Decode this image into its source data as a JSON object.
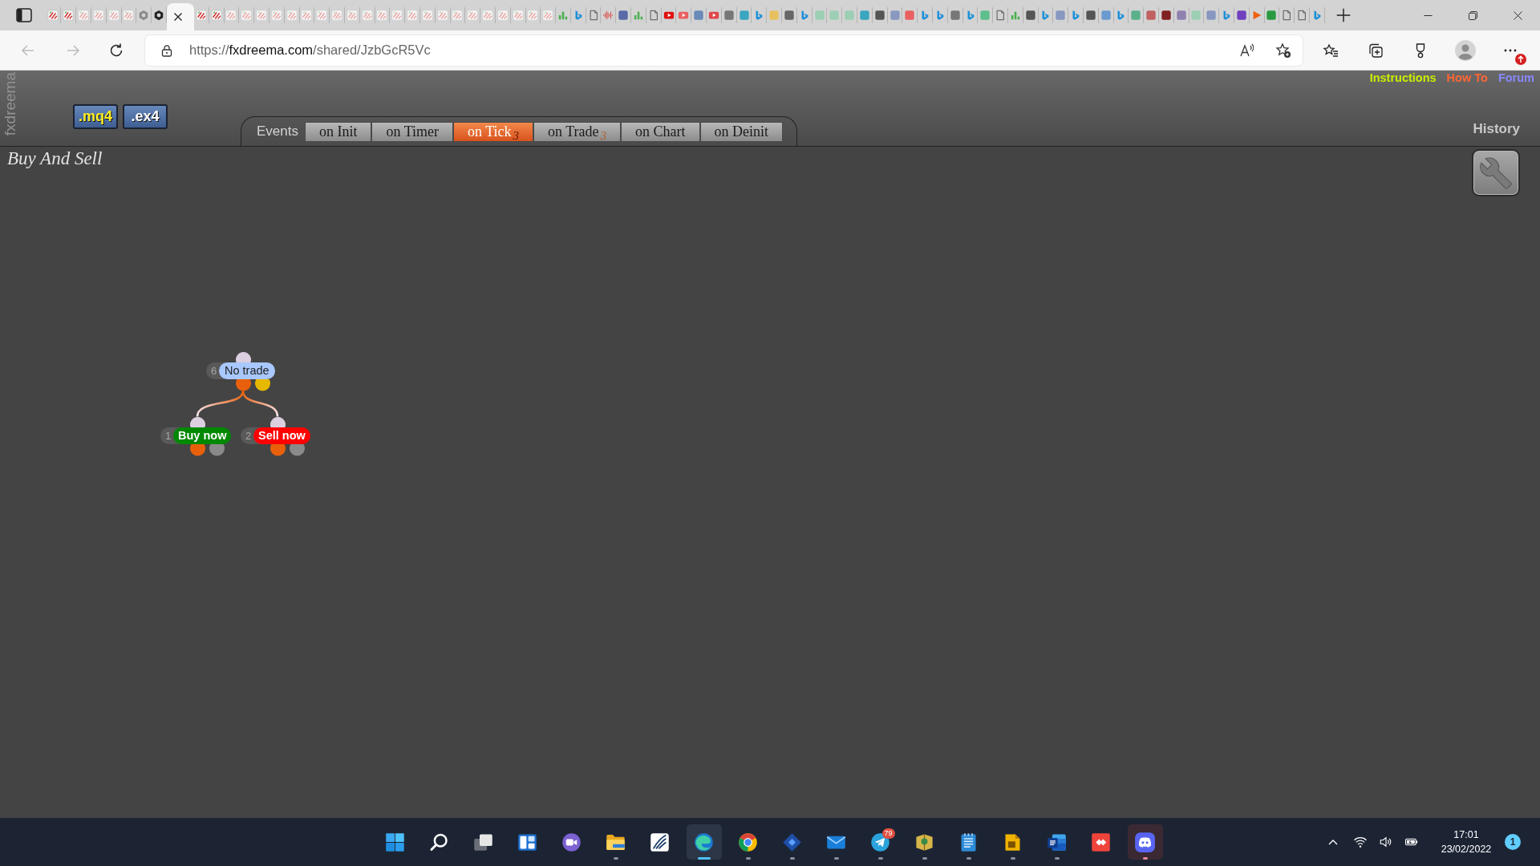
{
  "browser": {
    "tabs": [
      {
        "kind": "fx",
        "sleeping": false,
        "selected": false
      },
      {
        "kind": "fx",
        "sleeping": false,
        "selected": false
      },
      {
        "kind": "fx",
        "sleeping": true,
        "selected": false
      },
      {
        "kind": "fx",
        "sleeping": true,
        "selected": false
      },
      {
        "kind": "fx",
        "sleeping": true,
        "selected": false
      },
      {
        "kind": "fx",
        "sleeping": true,
        "selected": false
      },
      {
        "kind": "hex",
        "color": "#8a8a8a",
        "sleeping": false,
        "selected": false
      },
      {
        "kind": "hex",
        "color": "#222222",
        "sleeping": false,
        "selected": false
      },
      {
        "sleeping": false,
        "selected": true
      },
      {
        "kind": "fx",
        "sleeping": false,
        "selected": false
      },
      {
        "kind": "fx",
        "sleeping": false,
        "selected": false
      },
      {
        "kind": "fx",
        "sleeping": true,
        "selected": false
      },
      {
        "kind": "fx",
        "sleeping": true,
        "selected": false
      },
      {
        "kind": "fx",
        "sleeping": true,
        "selected": false
      },
      {
        "kind": "fx",
        "sleeping": true,
        "selected": false
      },
      {
        "kind": "fx",
        "sleeping": true,
        "selected": false
      },
      {
        "kind": "fx",
        "sleeping": true,
        "selected": false
      },
      {
        "kind": "fx",
        "sleeping": true,
        "selected": false
      },
      {
        "kind": "fx",
        "sleeping": true,
        "selected": false
      },
      {
        "kind": "fx",
        "sleeping": true,
        "selected": false
      },
      {
        "kind": "fx",
        "sleeping": true,
        "selected": false
      },
      {
        "kind": "fx",
        "sleeping": true,
        "selected": false
      },
      {
        "kind": "fx",
        "sleeping": true,
        "selected": false
      },
      {
        "kind": "fx",
        "sleeping": true,
        "selected": false
      },
      {
        "kind": "fx",
        "sleeping": true,
        "selected": false
      },
      {
        "kind": "fx",
        "sleeping": true,
        "selected": false
      },
      {
        "kind": "fx",
        "sleeping": true,
        "selected": false
      },
      {
        "kind": "fx",
        "sleeping": true,
        "selected": false
      },
      {
        "kind": "fx",
        "sleeping": true,
        "selected": false
      },
      {
        "kind": "fx",
        "sleeping": true,
        "selected": false
      },
      {
        "kind": "fx",
        "sleeping": true,
        "selected": false
      },
      {
        "kind": "fx",
        "sleeping": true,
        "selected": false
      },
      {
        "kind": "fx",
        "sleeping": true,
        "selected": false
      },
      {
        "kind": "bars",
        "sleeping": false,
        "selected": false
      },
      {
        "kind": "b",
        "sleeping": false,
        "selected": false
      },
      {
        "kind": "page",
        "sleeping": false,
        "selected": false
      },
      {
        "kind": "wave",
        "sleeping": false,
        "selected": false
      },
      {
        "kind": "tile",
        "color": "#5a6aa8",
        "sleeping": false,
        "selected": false
      },
      {
        "kind": "bars",
        "sleeping": false,
        "selected": false
      },
      {
        "kind": "page",
        "sleeping": false,
        "selected": false
      },
      {
        "kind": "play",
        "color": "#e01010",
        "sleeping": false,
        "selected": false
      },
      {
        "kind": "play",
        "color": "#e86060",
        "sleeping": false,
        "selected": false
      },
      {
        "kind": "tile",
        "color": "#6a8ab8",
        "sleeping": false,
        "selected": false
      },
      {
        "kind": "play",
        "color": "#e04848",
        "sleeping": false,
        "selected": false
      },
      {
        "kind": "tile",
        "color": "#777777",
        "sleeping": false,
        "selected": false
      },
      {
        "kind": "tile",
        "color": "#3aa6c0",
        "sleeping": false,
        "selected": false
      },
      {
        "kind": "b",
        "sleeping": false,
        "selected": false
      },
      {
        "kind": "tile",
        "color": "#e8c060",
        "sleeping": false,
        "selected": false
      },
      {
        "kind": "tile",
        "color": "#666666",
        "sleeping": false,
        "selected": false
      },
      {
        "kind": "b",
        "sleeping": false,
        "selected": false
      },
      {
        "kind": "tile",
        "color": "#9ccfb4",
        "sleeping": false,
        "selected": false
      },
      {
        "kind": "tile",
        "color": "#9ccfb4",
        "sleeping": false,
        "selected": false
      },
      {
        "kind": "tile",
        "color": "#9ccfb4",
        "sleeping": false,
        "selected": false
      },
      {
        "kind": "tile",
        "color": "#3aa6c0",
        "sleeping": false,
        "selected": false
      },
      {
        "kind": "tile",
        "color": "#555555",
        "sleeping": false,
        "selected": false
      },
      {
        "kind": "tile",
        "color": "#8898c0",
        "sleeping": false,
        "selected": false
      },
      {
        "kind": "tile",
        "color": "#e86060",
        "sleeping": false,
        "selected": false
      },
      {
        "kind": "b",
        "sleeping": false,
        "selected": false
      },
      {
        "kind": "b",
        "sleeping": false,
        "selected": false
      },
      {
        "kind": "tile",
        "color": "#777777",
        "sleeping": false,
        "selected": false
      },
      {
        "kind": "b",
        "sleeping": false,
        "selected": false
      },
      {
        "kind": "tile",
        "color": "#5cbf8c",
        "sleeping": false,
        "selected": false
      },
      {
        "kind": "page",
        "sleeping": false,
        "selected": false
      },
      {
        "kind": "bars",
        "sleeping": false,
        "selected": false
      },
      {
        "kind": "tile",
        "color": "#555555",
        "sleeping": false,
        "selected": false
      },
      {
        "kind": "b",
        "sleeping": false,
        "selected": false
      },
      {
        "kind": "tile",
        "color": "#8898c0",
        "sleeping": false,
        "selected": false
      },
      {
        "kind": "b",
        "sleeping": false,
        "selected": false
      },
      {
        "kind": "tile",
        "color": "#555555",
        "sleeping": false,
        "selected": false
      },
      {
        "kind": "tile",
        "color": "#6a9ad0",
        "sleeping": false,
        "selected": false
      },
      {
        "kind": "b",
        "sleeping": false,
        "selected": false
      },
      {
        "kind": "tile",
        "color": "#5ab08a",
        "sleeping": false,
        "selected": false
      },
      {
        "kind": "tile",
        "color": "#c06060",
        "sleeping": false,
        "selected": false
      },
      {
        "kind": "tile",
        "color": "#802020",
        "sleeping": false,
        "selected": false
      },
      {
        "kind": "tile",
        "color": "#9080b0",
        "sleeping": false,
        "selected": false
      },
      {
        "kind": "tile",
        "color": "#9ccfb4",
        "sleeping": false,
        "selected": false
      },
      {
        "kind": "tile",
        "color": "#8898c0",
        "sleeping": false,
        "selected": false
      },
      {
        "kind": "b",
        "sleeping": false,
        "selected": false
      },
      {
        "kind": "tile",
        "color": "#7040c0",
        "sleeping": false,
        "selected": false
      },
      {
        "kind": "triangle",
        "color": "#f06010",
        "sleeping": false,
        "selected": false
      },
      {
        "kind": "tile",
        "color": "#2a9a40",
        "sleeping": false,
        "selected": false
      },
      {
        "kind": "page",
        "sleeping": false,
        "selected": false
      },
      {
        "kind": "page",
        "sleeping": false,
        "selected": false
      },
      {
        "kind": "b",
        "sleeping": false,
        "selected": false
      }
    ],
    "nav": {
      "back_disabled": true,
      "forward_disabled": true
    },
    "url": {
      "scheme": "https://",
      "host": "fxdreema.com",
      "path": "/shared/JzbGcR5Vc"
    }
  },
  "header": {
    "brand": "fxdreema",
    "downloads": [
      {
        "label": ".mq4",
        "color": "#ffee22"
      },
      {
        "label": ".ex4",
        "color": "#ffffff"
      }
    ],
    "events_label": "Events",
    "event_tabs": [
      {
        "label": "on Init",
        "selected": false
      },
      {
        "label": "on Timer",
        "selected": false
      },
      {
        "label": "on Tick",
        "count": "3",
        "selected": true
      },
      {
        "label": "on Trade",
        "count": "3",
        "selected": false
      },
      {
        "label": "on Chart",
        "selected": false
      },
      {
        "label": "on Deinit",
        "selected": false
      }
    ],
    "links": [
      {
        "label": "Instructions",
        "color": "#ccee00"
      },
      {
        "label": "How To",
        "color": "#ff6633"
      },
      {
        "label": "Forum",
        "color": "#8888ff"
      }
    ],
    "history": "History"
  },
  "canvas": {
    "title": "Buy And Sell",
    "blocks": [
      {
        "kind": "condition",
        "number": "6",
        "label": "No trade",
        "color": "#a8c8ff",
        "outputs": [
          {
            "color": "#e8600c",
            "children": [
              {
                "kind": "action",
                "number": "1",
                "label": "Buy now",
                "color": "#008800",
                "outputs": [
                  {
                    "color": "#e8600c"
                  },
                  {
                    "color": "#8a8a8a"
                  }
                ]
              },
              {
                "kind": "action",
                "number": "2",
                "label": "Sell now",
                "color": "#ff0000",
                "outputs": [
                  {
                    "color": "#e8600c"
                  },
                  {
                    "color": "#8a8a8a"
                  }
                ]
              }
            ]
          },
          {
            "color": "#e6b800"
          }
        ]
      }
    ]
  },
  "taskbar": {
    "apps": [
      {
        "kind": "start",
        "running": false,
        "selected": false,
        "alert": false
      },
      {
        "kind": "search",
        "running": false,
        "selected": false,
        "alert": false
      },
      {
        "kind": "task_view",
        "running": false,
        "selected": false,
        "alert": false
      },
      {
        "kind": "widgets",
        "running": false,
        "selected": false,
        "alert": false
      },
      {
        "kind": "chat",
        "running": false,
        "selected": false,
        "alert": false
      },
      {
        "kind": "files",
        "running": true,
        "selected": false,
        "alert": false
      },
      {
        "kind": "feather",
        "running": false,
        "selected": false,
        "alert": false
      },
      {
        "kind": "edge",
        "running": true,
        "selected": true,
        "alert": false
      },
      {
        "kind": "chrome",
        "running": true,
        "selected": false,
        "alert": false
      },
      {
        "kind": "diamond",
        "running": true,
        "selected": false,
        "alert": false
      },
      {
        "kind": "mail",
        "running": true,
        "selected": false,
        "alert": false
      },
      {
        "kind": "telegram",
        "running": true,
        "selected": false,
        "alert": false,
        "badge": "79"
      },
      {
        "kind": "book",
        "running": true,
        "selected": false,
        "alert": false
      },
      {
        "kind": "notepad",
        "running": true,
        "selected": false,
        "alert": false
      },
      {
        "kind": "doc",
        "running": true,
        "selected": false,
        "alert": false
      },
      {
        "kind": "word",
        "running": true,
        "selected": false,
        "alert": false
      },
      {
        "kind": "anydesk",
        "running": false,
        "selected": false,
        "alert": false
      },
      {
        "kind": "discord",
        "running": true,
        "selected": false,
        "alert": true
      }
    ],
    "time": "17:01",
    "date": "23/02/2022",
    "notifications": "1"
  }
}
